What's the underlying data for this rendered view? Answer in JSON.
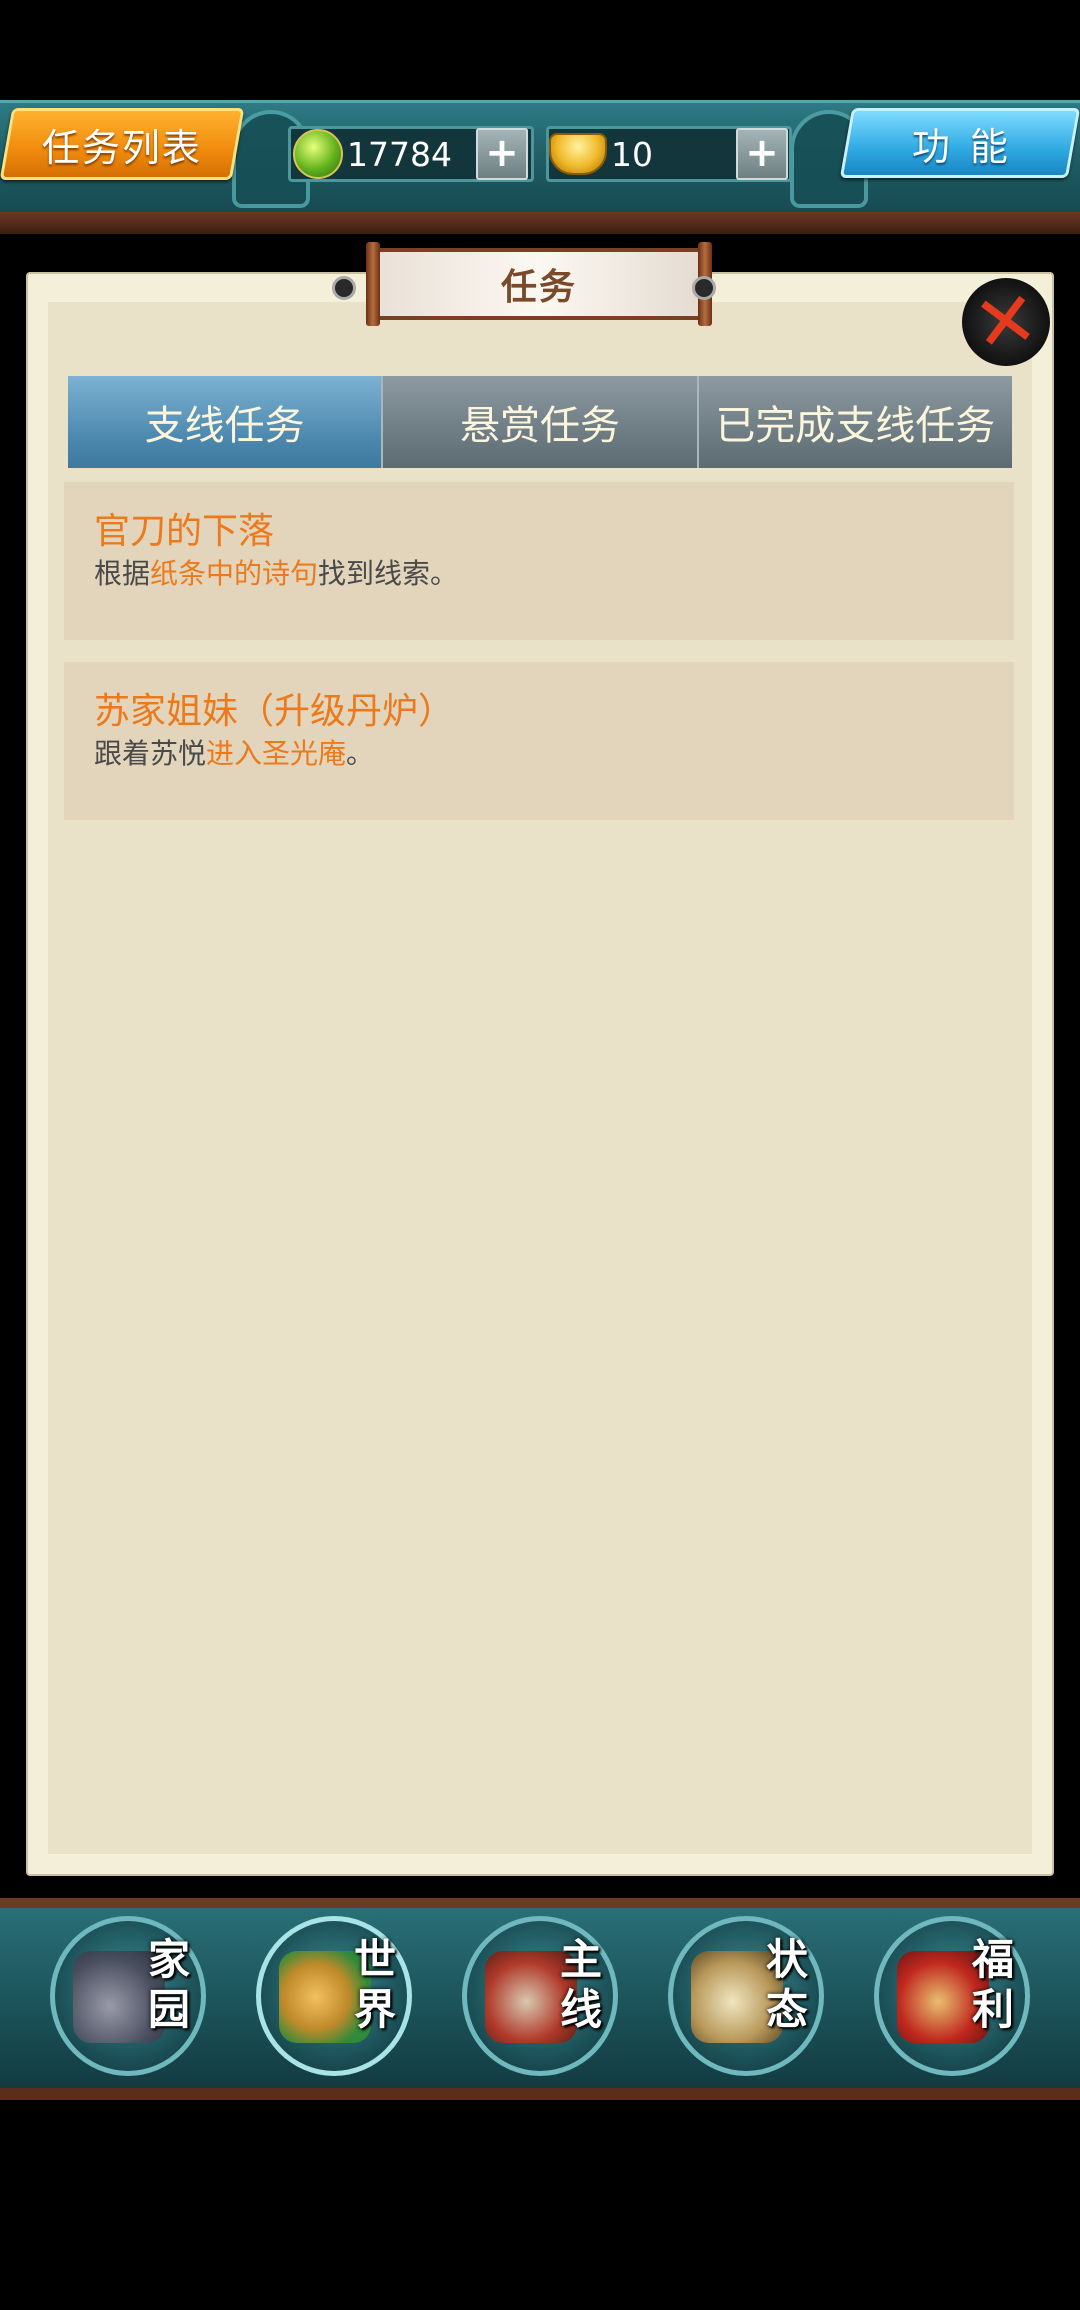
{
  "header": {
    "task_list_label": "任务列表",
    "function_label": "功能",
    "currency": [
      {
        "icon": "jade-coin-icon",
        "value": "17784",
        "add_label": "+"
      },
      {
        "icon": "gold-ingot-icon",
        "value": "10",
        "add_label": "+"
      }
    ]
  },
  "panel": {
    "title": "任务",
    "close_icon": "close-x-icon",
    "tabs": [
      {
        "label": "支线任务",
        "active": true
      },
      {
        "label": "悬赏任务",
        "active": false
      },
      {
        "label": "已完成支线任务",
        "active": false
      }
    ],
    "quests": [
      {
        "title": "官刀的下落",
        "desc_pre": "根据",
        "desc_hl": "纸条中的诗句",
        "desc_post": "找到线索。"
      },
      {
        "title": "苏家姐妹（升级丹炉）",
        "desc_pre": "跟着苏悦",
        "desc_hl": "进入圣光庵",
        "desc_post": "。"
      }
    ]
  },
  "nav": [
    {
      "label": "家园",
      "icon": "home-icon"
    },
    {
      "label": "世界",
      "icon": "world-icon"
    },
    {
      "label": "主线",
      "icon": "main-quest-icon"
    },
    {
      "label": "状态",
      "icon": "status-icon"
    },
    {
      "label": "福利",
      "icon": "welfare-icon"
    }
  ],
  "colors": {
    "accent_orange": "#ec7a1c",
    "tab_active": "#4b87ad",
    "tab_inactive": "#6a7880",
    "panel_bg": "#e9e2c9"
  }
}
